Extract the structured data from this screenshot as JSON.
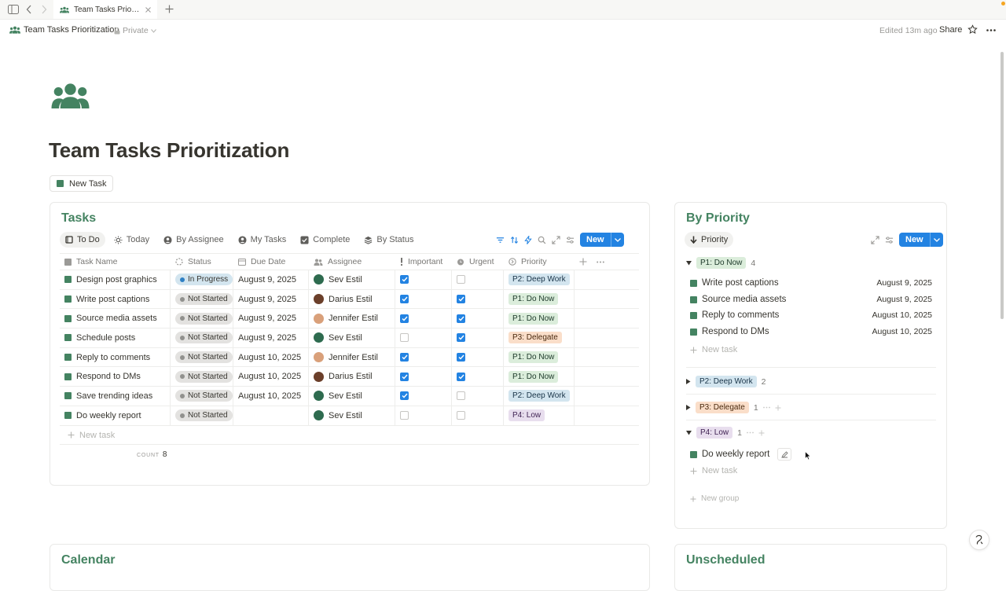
{
  "tab": {
    "title": "Team Tasks Prioritiza..."
  },
  "header": {
    "page_name": "Team Tasks Prioritization",
    "privacy": "Private",
    "edited": "Edited 13m ago",
    "share": "Share"
  },
  "page": {
    "title": "Team Tasks Prioritization",
    "new_task_button": "New Task"
  },
  "tasks": {
    "title": "Tasks",
    "views": [
      "To Do",
      "Today",
      "By Assignee",
      "My Tasks",
      "Complete",
      "By Status"
    ],
    "new_label": "New",
    "columns": [
      "Task Name",
      "Status",
      "Due Date",
      "Assignee",
      "Important",
      "Urgent",
      "Priority"
    ],
    "rows": [
      {
        "name": "Design post graphics",
        "status": "In Progress",
        "due": "August 9, 2025",
        "assignee": "Sev Estil",
        "important": true,
        "urgent": false,
        "priority": "P2: Deep Work"
      },
      {
        "name": "Write post captions",
        "status": "Not Started",
        "due": "August 9, 2025",
        "assignee": "Darius Estil",
        "important": true,
        "urgent": true,
        "priority": "P1: Do Now"
      },
      {
        "name": "Source media assets",
        "status": "Not Started",
        "due": "August 9, 2025",
        "assignee": "Jennifer Estil",
        "important": true,
        "urgent": true,
        "priority": "P1: Do Now"
      },
      {
        "name": "Schedule posts",
        "status": "Not Started",
        "due": "August 9, 2025",
        "assignee": "Sev Estil",
        "important": false,
        "urgent": true,
        "priority": "P3: Delegate"
      },
      {
        "name": "Reply to comments",
        "status": "Not Started",
        "due": "August 10, 2025",
        "assignee": "Jennifer Estil",
        "important": true,
        "urgent": true,
        "priority": "P1: Do Now"
      },
      {
        "name": "Respond to DMs",
        "status": "Not Started",
        "due": "August 10, 2025",
        "assignee": "Darius Estil",
        "important": true,
        "urgent": true,
        "priority": "P1: Do Now"
      },
      {
        "name": "Save trending ideas",
        "status": "Not Started",
        "due": "August 10, 2025",
        "assignee": "Sev Estil",
        "important": true,
        "urgent": false,
        "priority": "P2: Deep Work"
      },
      {
        "name": "Do weekly report",
        "status": "Not Started",
        "due": "",
        "assignee": "Sev Estil",
        "important": false,
        "urgent": false,
        "priority": "P4: Low"
      }
    ],
    "new_task": "New task",
    "count_label": "COUNT",
    "count": "8"
  },
  "priority_board": {
    "title": "By Priority",
    "view": "Priority",
    "new_label": "New",
    "groups": [
      {
        "label": "P1: Do Now",
        "count": "4",
        "items": [
          {
            "name": "Write post captions",
            "date": "August 9, 2025"
          },
          {
            "name": "Source media assets",
            "date": "August 9, 2025"
          },
          {
            "name": "Reply to comments",
            "date": "August 10, 2025"
          },
          {
            "name": "Respond to DMs",
            "date": "August 10, 2025"
          }
        ]
      },
      {
        "label": "P2: Deep Work",
        "count": "2",
        "items": []
      },
      {
        "label": "P3: Delegate",
        "count": "1",
        "items": []
      },
      {
        "label": "P4: Low",
        "count": "1",
        "items": [
          {
            "name": "Do weekly report",
            "date": ""
          }
        ]
      }
    ],
    "new_task": "New task",
    "new_group": "New group"
  },
  "calendar": {
    "title": "Calendar"
  },
  "unscheduled": {
    "title": "Unscheduled"
  },
  "colors": {
    "accent": "#448361",
    "blue": "#2383e2"
  }
}
